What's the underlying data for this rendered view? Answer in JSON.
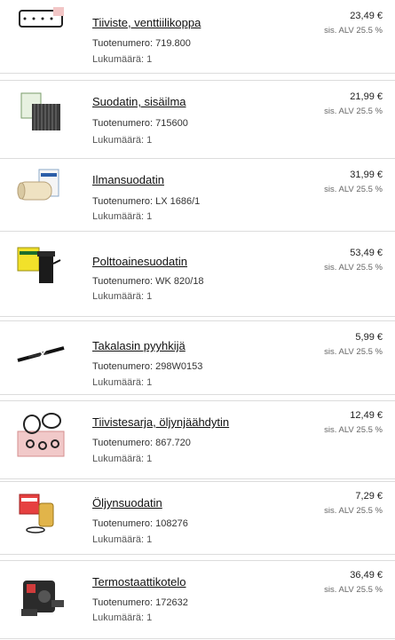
{
  "items": [
    {
      "name": "Tiiviste, venttiilikoppa",
      "number_label": "Tuotenumero: 719.800",
      "qty_label": "Lukumäärä: 1",
      "price": "23,49 €",
      "vat": "sis. ALV 25.5 %",
      "image": "gasket-icon"
    },
    {
      "name": "Suodatin, sisäilma",
      "number_label": "Tuotenumero: 715600",
      "qty_label": "Lukumäärä: 1",
      "price": "21,99 €",
      "vat": "sis. ALV 25.5 %",
      "image": "cabin-filter-icon"
    },
    {
      "name": "Ilmansuodatin",
      "number_label": "Tuotenumero: LX 1686/1",
      "qty_label": "Lukumäärä: 1",
      "price": "31,99 €",
      "vat": "sis. ALV 25.5 %",
      "image": "air-filter-icon"
    },
    {
      "name": "Polttoainesuodatin",
      "number_label": "Tuotenumero: WK 820/18",
      "qty_label": "Lukumäärä: 1",
      "price": "53,49 €",
      "vat": "sis. ALV 25.5 %",
      "image": "fuel-filter-icon"
    },
    {
      "name": "Takalasin pyyhkijä",
      "number_label": "Tuotenumero: 298W0153",
      "qty_label": "Lukumäärä: 1",
      "price": "5,99 €",
      "vat": "sis. ALV 25.5 %",
      "image": "wiper-icon"
    },
    {
      "name": "Tiivistesarja, öljynjäähdytin",
      "number_label": "Tuotenumero: 867.720",
      "qty_label": "Lukumäärä: 1",
      "price": "12,49 €",
      "vat": "sis. ALV 25.5 %",
      "image": "seal-kit-icon"
    },
    {
      "name": "Öljynsuodatin",
      "number_label": "Tuotenumero: 108276",
      "qty_label": "Lukumäärä: 1",
      "price": "7,29 €",
      "vat": "sis. ALV 25.5 %",
      "image": "oil-filter-icon"
    },
    {
      "name": "Termostaattikotelo",
      "number_label": "Tuotenumero: 172632",
      "qty_label": "Lukumäärä: 1",
      "price": "36,49 €",
      "vat": "sis. ALV 25.5 %",
      "image": "thermostat-housing-icon"
    }
  ]
}
